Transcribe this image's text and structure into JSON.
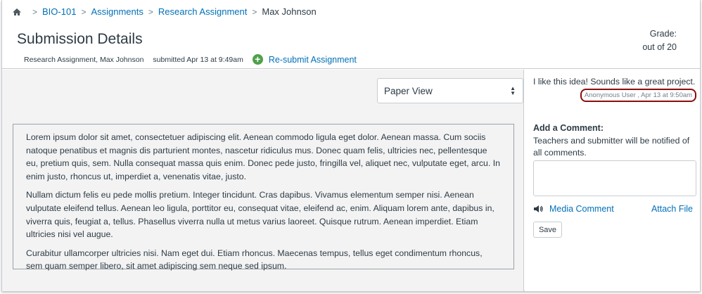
{
  "breadcrumb": {
    "items": [
      "BIO-101",
      "Assignments",
      "Research Assignment"
    ],
    "current": "Max Johnson"
  },
  "header": {
    "title": "Submission Details",
    "assignment_info": "Research Assignment, Max Johnson",
    "submitted": "submitted Apr 13 at 9:49am",
    "resubmit_label": "Re-submit Assignment",
    "grade_label": "Grade:",
    "grade_out_of": "out of 20"
  },
  "main": {
    "view_select": "Paper View",
    "paragraphs": [
      "Lorem ipsum dolor sit amet, consectetuer adipiscing elit. Aenean commodo ligula eget dolor. Aenean massa. Cum sociis natoque penatibus et magnis dis parturient montes, nascetur ridiculus mus. Donec quam felis, ultricies nec, pellentesque eu, pretium quis, sem. Nulla consequat massa quis enim. Donec pede justo, fringilla vel, aliquet nec, vulputate eget, arcu. In enim justo, rhoncus ut, imperdiet a, venenatis vitae, justo.",
      "Nullam dictum felis eu pede mollis pretium. Integer tincidunt. Cras dapibus. Vivamus elementum semper nisi. Aenean vulputate eleifend tellus. Aenean leo ligula, porttitor eu, consequat vitae, eleifend ac, enim. Aliquam lorem ante, dapibus in, viverra quis, feugiat a, tellus. Phasellus viverra nulla ut metus varius laoreet. Quisque rutrum. Aenean imperdiet. Etiam ultricies nisi vel augue.",
      "Curabitur ullamcorper ultricies nisi. Nam eget dui. Etiam rhoncus. Maecenas tempus, tellus eget condimentum rhoncus, sem quam semper libero, sit amet adipiscing sem neque sed ipsum."
    ]
  },
  "sidebar": {
    "comment_text": "I like this idea! Sounds like a great project.",
    "comment_meta": "Anonymous User , Apr 13 at 9:50am",
    "add_comment_title": "Add a Comment:",
    "add_comment_note": "Teachers and submitter will be notified of all comments.",
    "media_comment_label": "Media Comment",
    "attach_file_label": "Attach File",
    "save_label": "Save"
  },
  "icons": {
    "home": "home-icon",
    "separator": "chevron-right-icon",
    "resubmit": "plus-circle-icon",
    "media": "speaker-icon",
    "select": "select-arrows-icon"
  },
  "colors": {
    "link": "#0070b8",
    "plus_icon": "#4fa04a",
    "highlight": "#8b0d0d"
  }
}
